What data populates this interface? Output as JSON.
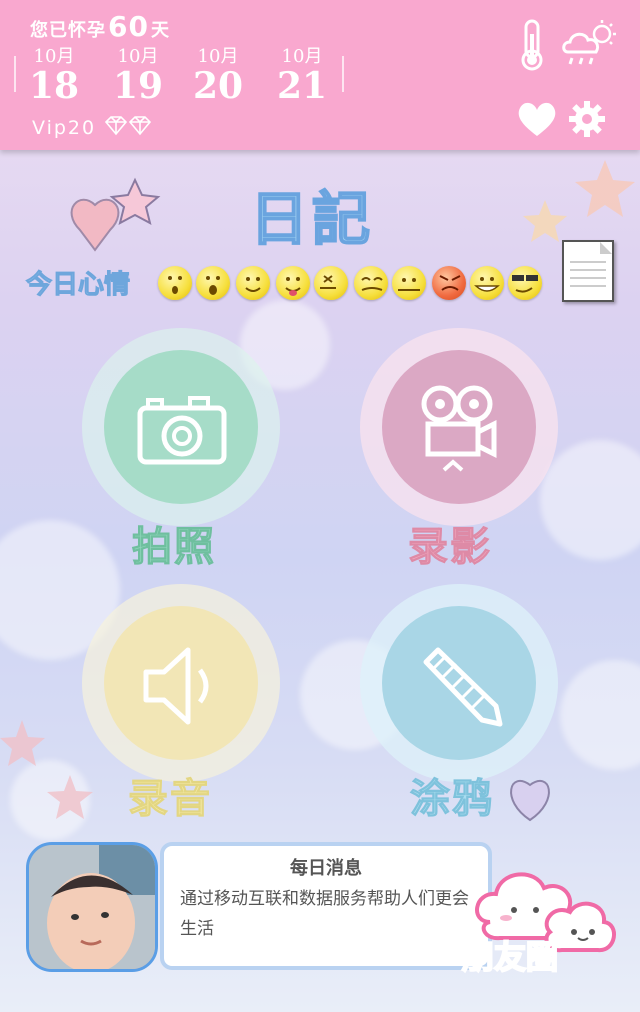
{
  "header": {
    "pregnancy_prefix": "您已怀孕",
    "pregnancy_days": "60",
    "pregnancy_suffix": "天",
    "dates": [
      {
        "month": "10月",
        "day": "18"
      },
      {
        "month": "10月",
        "day": "19"
      },
      {
        "month": "10月",
        "day": "20"
      },
      {
        "month": "10月",
        "day": "21"
      }
    ],
    "vip": "Vip20",
    "icons": [
      "thermometer-icon",
      "weather-icon",
      "heart-icon",
      "gear-icon"
    ]
  },
  "diary": {
    "title": "日記",
    "mood_label": "今日心情",
    "moods": [
      "surprised",
      "shocked",
      "smile",
      "tongue",
      "sealed",
      "sleepy",
      "neutral",
      "angry",
      "grin",
      "cool"
    ]
  },
  "actions": [
    {
      "label": "拍照",
      "icon": "camera-icon",
      "color": "#8fd6bb"
    },
    {
      "label": "录影",
      "icon": "video-camera-icon",
      "color": "#f3a9c0"
    },
    {
      "label": "录音",
      "icon": "speaker-icon",
      "color": "#f5ecaa"
    },
    {
      "label": "涂鸦",
      "icon": "pencil-icon",
      "color": "#a9dcef"
    }
  ],
  "message": {
    "title": "每日消息",
    "body": "通过移动互联和数据服务帮助人们更会生活"
  },
  "friends": {
    "label": "朋友圈"
  }
}
